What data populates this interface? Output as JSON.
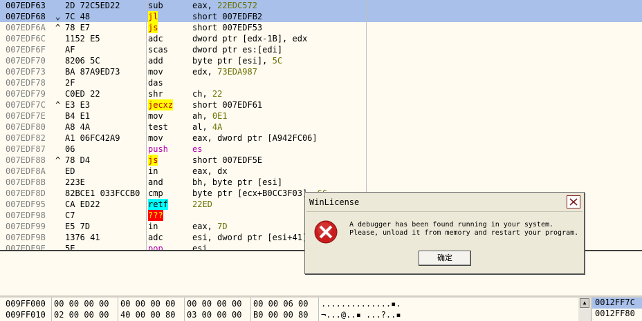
{
  "disasm": {
    "rows": [
      {
        "addr": "007EDF63",
        "mark": "",
        "hex": "2D 72C5ED22",
        "mn": "sub",
        "op": [
          {
            "t": "eax, "
          },
          {
            "t": "22EDC572",
            "c": "num"
          }
        ],
        "hl": true
      },
      {
        "addr": "007EDF68",
        "mark": "⌄",
        "hex": "7C 48",
        "mn": "jl",
        "mc": "jmp",
        "op": [
          {
            "t": "short 007EDFB2"
          }
        ],
        "hl": true
      },
      {
        "addr": "007EDF6A",
        "mark": "^",
        "hex": "78 E7",
        "mn": "js",
        "mc": "jmp",
        "op": [
          {
            "t": "short 007EDF53"
          }
        ]
      },
      {
        "addr": "007EDF6C",
        "mark": "",
        "hex": "1152 E5",
        "mn": "adc",
        "op": [
          {
            "t": "dword ptr [edx-1B], edx"
          }
        ]
      },
      {
        "addr": "007EDF6F",
        "mark": "",
        "hex": "AF",
        "mn": "scas",
        "op": [
          {
            "t": "dword ptr es:[edi]"
          }
        ]
      },
      {
        "addr": "007EDF70",
        "mark": "",
        "hex": "8206 5C",
        "mn": "add",
        "op": [
          {
            "t": "byte ptr [esi], "
          },
          {
            "t": "5C",
            "c": "num"
          }
        ]
      },
      {
        "addr": "007EDF73",
        "mark": "",
        "hex": "BA 87A9ED73",
        "mn": "mov",
        "op": [
          {
            "t": "edx, "
          },
          {
            "t": "73EDA987",
            "c": "num"
          }
        ]
      },
      {
        "addr": "007EDF78",
        "mark": "",
        "hex": "2F",
        "mn": "das",
        "op": []
      },
      {
        "addr": "007EDF79",
        "mark": "",
        "hex": "C0ED 22",
        "mn": "shr",
        "op": [
          {
            "t": "ch, "
          },
          {
            "t": "22",
            "c": "num"
          }
        ]
      },
      {
        "addr": "007EDF7C",
        "mark": "^",
        "hex": "E3 E3",
        "mn": "jecxz",
        "mc": "jmp",
        "op": [
          {
            "t": "short 007EDF61"
          }
        ]
      },
      {
        "addr": "007EDF7E",
        "mark": "",
        "hex": "B4 E1",
        "mn": "mov",
        "op": [
          {
            "t": "ah, "
          },
          {
            "t": "0E1",
            "c": "num"
          }
        ]
      },
      {
        "addr": "007EDF80",
        "mark": "",
        "hex": "A8 4A",
        "mn": "test",
        "op": [
          {
            "t": "al, "
          },
          {
            "t": "4A",
            "c": "num"
          }
        ]
      },
      {
        "addr": "007EDF82",
        "mark": "",
        "hex": "A1 06FC42A9",
        "mn": "mov",
        "op": [
          {
            "t": "eax, dword ptr [A942FC06]"
          }
        ]
      },
      {
        "addr": "007EDF87",
        "mark": "",
        "hex": "06",
        "mn": "push",
        "mc": "push",
        "op": [
          {
            "t": "es",
            "c": "reg-es"
          }
        ]
      },
      {
        "addr": "007EDF88",
        "mark": "^",
        "hex": "78 D4",
        "mn": "js",
        "mc": "jmp",
        "op": [
          {
            "t": "short 007EDF5E"
          }
        ]
      },
      {
        "addr": "007EDF8A",
        "mark": "",
        "hex": "ED",
        "mn": "in",
        "op": [
          {
            "t": "eax, dx"
          }
        ]
      },
      {
        "addr": "007EDF8B",
        "mark": "",
        "hex": "223E",
        "mn": "and",
        "op": [
          {
            "t": "bh, byte ptr [esi]"
          }
        ]
      },
      {
        "addr": "007EDF8D",
        "mark": "",
        "hex": "82BCE1 033FCCB0",
        "mn": "cmp",
        "op": [
          {
            "t": "byte ptr [ecx+B0CC3F03], "
          },
          {
            "t": "66",
            "c": "num"
          }
        ]
      },
      {
        "addr": "007EDF95",
        "mark": "",
        "hex": "CA ED22",
        "mn": "retf",
        "mc": "ret",
        "op": [
          {
            "t": "22ED",
            "c": "num"
          }
        ]
      },
      {
        "addr": "007EDF98",
        "mark": "",
        "hex": "C7",
        "mn": "???",
        "mc": "bad",
        "op": []
      },
      {
        "addr": "007EDF99",
        "mark": "",
        "hex": "E5 7D",
        "mn": "in",
        "op": [
          {
            "t": "eax, "
          },
          {
            "t": "7D",
            "c": "num"
          }
        ]
      },
      {
        "addr": "007EDF9B",
        "mark": "",
        "hex": "1376 41",
        "mn": "adc",
        "op": [
          {
            "t": "esi, dword ptr [esi+41]"
          }
        ]
      },
      {
        "addr": "007EDF9E",
        "mark": "",
        "hex": "5E",
        "mn": "pop",
        "mc": "push",
        "op": [
          {
            "t": "esi"
          }
        ]
      }
    ]
  },
  "dump": {
    "rows": [
      {
        "addr": "009FF000",
        "g1": "00 00 00 00",
        "g2": "00 00 00 00",
        "g3": "00 00 00 00",
        "g4": "00 00 06 00",
        "ascii": "..............▪."
      },
      {
        "addr": "009FF010",
        "g1": "02 00 00 00",
        "g2": "40 00 00 80",
        "g3": "03 00 00 00",
        "g4": "B0 00 00 80",
        "ascii": "¬...@..▪ ...?..▪"
      }
    ]
  },
  "stack": {
    "rows": [
      "0012FF7C",
      "0012FF80"
    ],
    "scroll_up_icon": "triangle-up"
  },
  "dialog": {
    "title": "WinLicense",
    "message": "A debugger has been found running in your system.\nPlease, unload it from memory and restart your program.",
    "ok_label": "确定",
    "icon": "error-icon"
  },
  "colors": {
    "pane_bg": "#fffbf0",
    "selection": "#a8c0ea",
    "jump_bg": "#ffff00",
    "jump_fg": "#c00000",
    "ret_bg": "#00ffff",
    "bad_bg": "#ff0000",
    "number": "#6a7000",
    "segment": "#b000b0"
  }
}
